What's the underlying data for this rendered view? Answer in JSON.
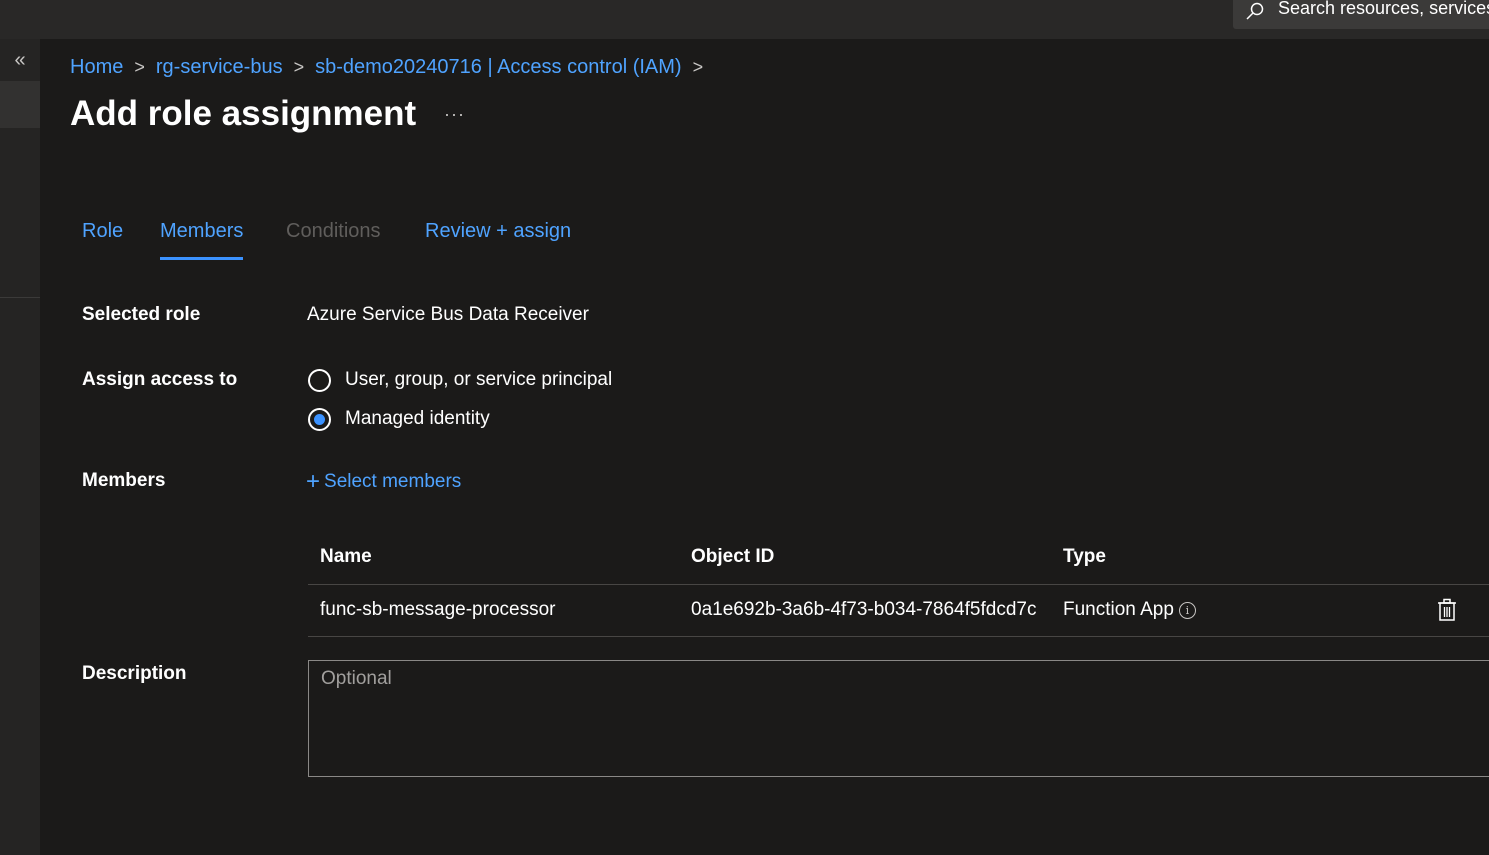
{
  "search": {
    "placeholder": "Search resources, services, and docs (G+/)"
  },
  "breadcrumb": {
    "items": [
      "Home",
      "rg-service-bus",
      "sb-demo20240716 | Access control (IAM)"
    ]
  },
  "page": {
    "title": "Add role assignment"
  },
  "tabs": [
    "Role",
    "Members",
    "Conditions",
    "Review + assign"
  ],
  "form": {
    "selected_role_label": "Selected role",
    "selected_role_value": "Azure Service Bus Data Receiver",
    "assign_access_label": "Assign access to",
    "assign_options": [
      "User, group, or service principal",
      "Managed identity"
    ],
    "assign_selected": "Managed identity",
    "members_label": "Members",
    "select_members": "Select members",
    "description_label": "Description",
    "description_placeholder": "Optional"
  },
  "members_table": {
    "columns": [
      "Name",
      "Object ID",
      "Type"
    ],
    "rows": [
      {
        "name": "func-sb-message-processor",
        "object_id": "0a1e692b-3a6b-4f73-b034-7864f5fdcd7c",
        "type": "Function App"
      }
    ]
  },
  "colors": {
    "accent": "#3b92ff",
    "link": "#4fa3ff",
    "background": "#1b1a19"
  }
}
